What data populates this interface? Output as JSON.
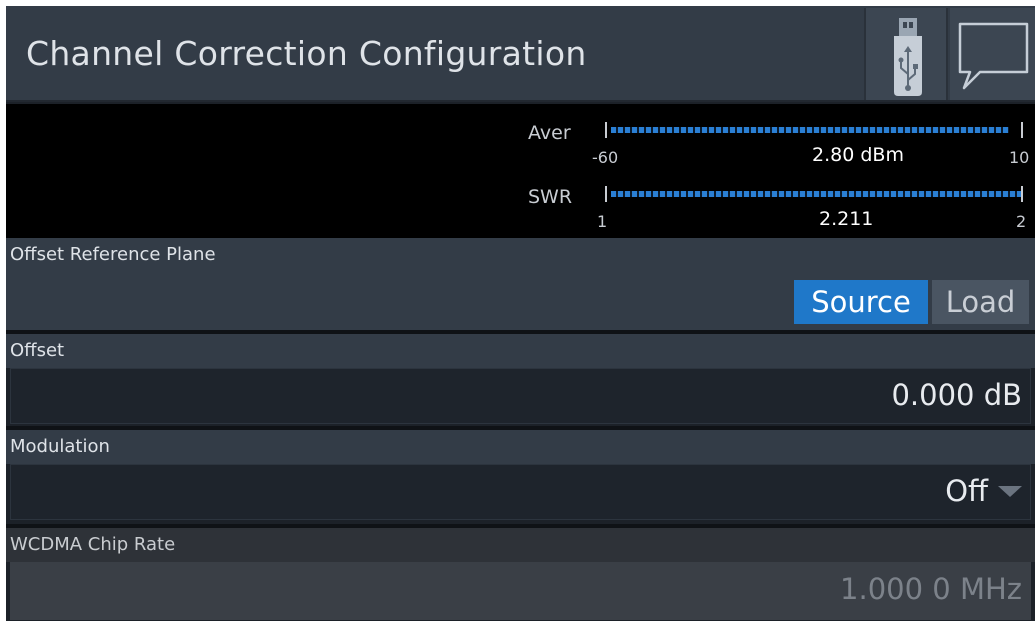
{
  "header": {
    "title": "Channel Correction Configuration",
    "usb_icon": "usb-icon",
    "message_icon": "speech-bubble-icon"
  },
  "meters": {
    "average": {
      "label": "Aver",
      "min_label": "-60",
      "max_label": "10",
      "value_text": "2.80 dBm",
      "fill_fraction": 0.97
    },
    "swr": {
      "label": "SWR",
      "min_label": "1",
      "max_label": "2",
      "value_text": "2.211",
      "fill_fraction": 1.0
    }
  },
  "offset_reference_plane": {
    "label": "Offset Reference Plane",
    "options": [
      "Source",
      "Load"
    ],
    "selected": "Source"
  },
  "offset": {
    "label": "Offset",
    "value": "0.000 dB"
  },
  "modulation": {
    "label": "Modulation",
    "value": "Off"
  },
  "wcdma_chip_rate": {
    "label": "WCDMA Chip Rate",
    "value": "1.000 0 MHz",
    "enabled": false
  },
  "colors": {
    "accent": "#1f78c9",
    "meter_bar": "#2a7fd4",
    "panel": "#333c47",
    "background": "#1c2128"
  }
}
